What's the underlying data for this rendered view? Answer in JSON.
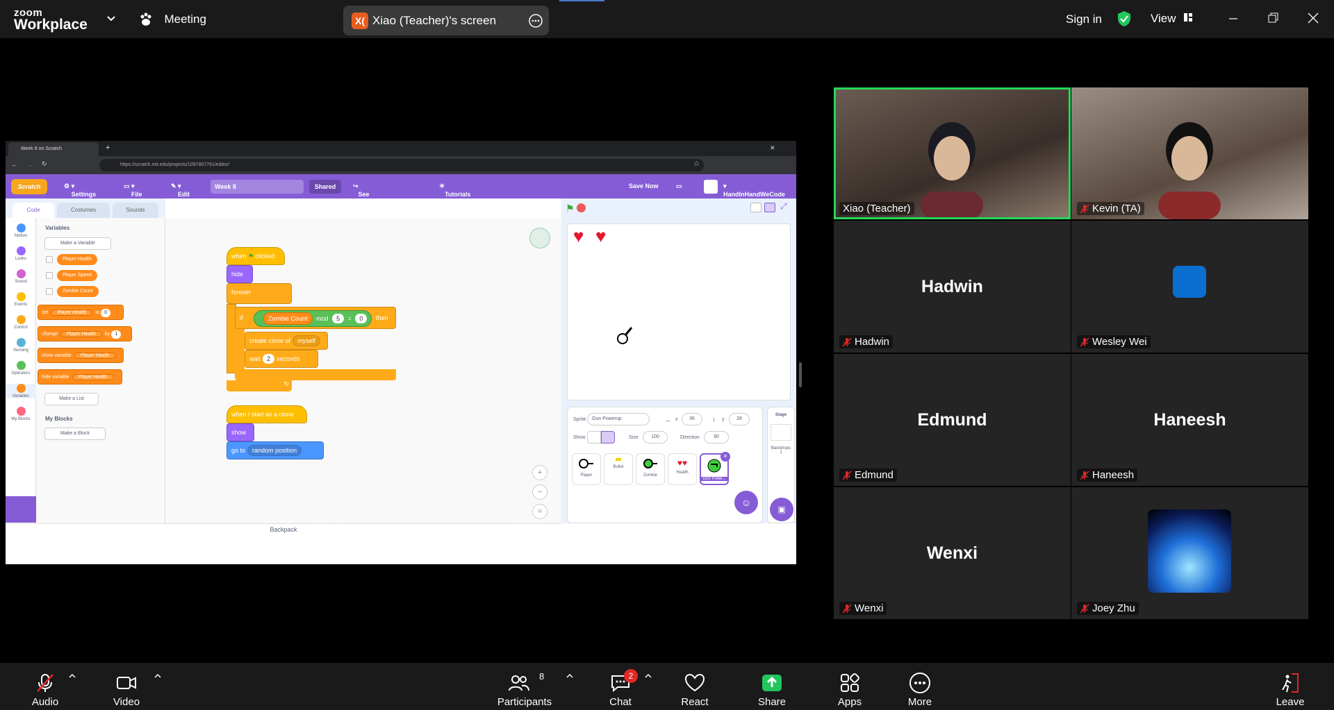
{
  "topbar": {
    "brand_top": "zoom",
    "brand_bottom": "Workplace",
    "meeting_label": "Meeting",
    "share_chip_icon": "X(",
    "share_chip_label": "Xiao (Teacher)'s screen",
    "sign_in": "Sign in",
    "view": "View"
  },
  "browser": {
    "tab_title": "Week 8 on Scratch",
    "url": "https://scratch.mit.edu/projects/1097807761/editor/"
  },
  "scratch": {
    "logo": "Scratch",
    "menu": {
      "settings": "Settings",
      "file": "File",
      "edit": "Edit",
      "project_title": "Week 8",
      "shared": "Shared",
      "see_project_page": "See Project Page",
      "tutorials": "Tutorials",
      "save_now": "Save Now",
      "username": "HandInHandWeCode"
    },
    "tabs": {
      "code": "Code",
      "costumes": "Costumes",
      "sounds": "Sounds"
    },
    "categories": [
      {
        "label": "Motion",
        "color": "#4c97ff"
      },
      {
        "label": "Looks",
        "color": "#9966ff"
      },
      {
        "label": "Sound",
        "color": "#cf63cf"
      },
      {
        "label": "Events",
        "color": "#ffbf00"
      },
      {
        "label": "Control",
        "color": "#ffab19"
      },
      {
        "label": "Sensing",
        "color": "#5cb1d6"
      },
      {
        "label": "Operators",
        "color": "#59c059"
      },
      {
        "label": "Variables",
        "color": "#ff8c1a"
      },
      {
        "label": "My Blocks",
        "color": "#ff6680"
      }
    ],
    "palette": {
      "variables_heading": "Variables",
      "make_variable": "Make a Variable",
      "variables": [
        "Player Health",
        "Player Speed",
        "Zombie Count"
      ],
      "set_block": {
        "verb": "set",
        "var": "Player Health",
        "to": "to",
        "value": "0"
      },
      "change_block": {
        "verb": "change",
        "var": "Player Health",
        "by": "by",
        "value": "1"
      },
      "show_block": {
        "verb": "show variable",
        "var": "Player Health"
      },
      "hide_block": {
        "verb": "hide variable",
        "var": "Player Health"
      },
      "make_list": "Make a List",
      "myblocks_heading": "My Blocks",
      "make_block": "Make a Block"
    },
    "code": {
      "when_clicked_pre": "when",
      "when_clicked_post": "clicked",
      "hide": "hide",
      "forever": "forever",
      "if": "if",
      "zombie_count": "Zombie Count",
      "mod": "mod",
      "mod_value": "5",
      "equals": "=",
      "eq_value": "0",
      "then": "then",
      "create_clone": "create clone of",
      "myself": "myself",
      "wait": "wait",
      "wait_value": "2",
      "seconds": "seconds",
      "when_clone": "when I start as a clone",
      "show": "show",
      "go_to": "go to",
      "random_position": "random position"
    },
    "backpack": "Backpack",
    "sprite_info": {
      "sprite_label": "Sprite",
      "sprite_name": "Gun Powerup",
      "x_label": "x",
      "x": "36",
      "y_label": "y",
      "y": "28",
      "show_label": "Show",
      "size_label": "Size",
      "size": "100",
      "direction_label": "Direction",
      "direction": "90"
    },
    "sprites": [
      {
        "name": "Player"
      },
      {
        "name": "Bullet"
      },
      {
        "name": "Zombie"
      },
      {
        "name": "Health"
      },
      {
        "name": "Gun Powe..."
      }
    ],
    "stage_panel": {
      "title": "Stage",
      "backdrops_label": "Backdrops",
      "backdrops_count": "1"
    }
  },
  "gallery": {
    "participants": [
      {
        "name": "Xiao (Teacher)",
        "muted": false,
        "active": true,
        "kind": "video"
      },
      {
        "name": "Kevin (TA)",
        "muted": true,
        "active": false,
        "kind": "video"
      },
      {
        "name": "Hadwin",
        "display": "Hadwin",
        "muted": true,
        "kind": "name"
      },
      {
        "name": "Wesley Wei",
        "muted": true,
        "kind": "avatar"
      },
      {
        "name": "Edmund",
        "display": "Edmund",
        "muted": true,
        "kind": "name"
      },
      {
        "name": "Haneesh",
        "display": "Haneesh",
        "muted": true,
        "kind": "name"
      },
      {
        "name": "Wenxi",
        "display": "Wenxi",
        "muted": true,
        "kind": "name"
      },
      {
        "name": "Joey Zhu",
        "muted": true,
        "kind": "image"
      }
    ]
  },
  "bottombar": {
    "audio": "Audio",
    "video": "Video",
    "participants": "Participants",
    "participants_count": "8",
    "chat": "Chat",
    "chat_badge": "2",
    "react": "React",
    "share": "Share",
    "apps": "Apps",
    "more": "More",
    "leave": "Leave"
  },
  "colors": {
    "active_speaker": "#23d959",
    "share_green": "#23c55e",
    "scratch_purple": "#855cd6",
    "mute_red": "#e02828"
  }
}
